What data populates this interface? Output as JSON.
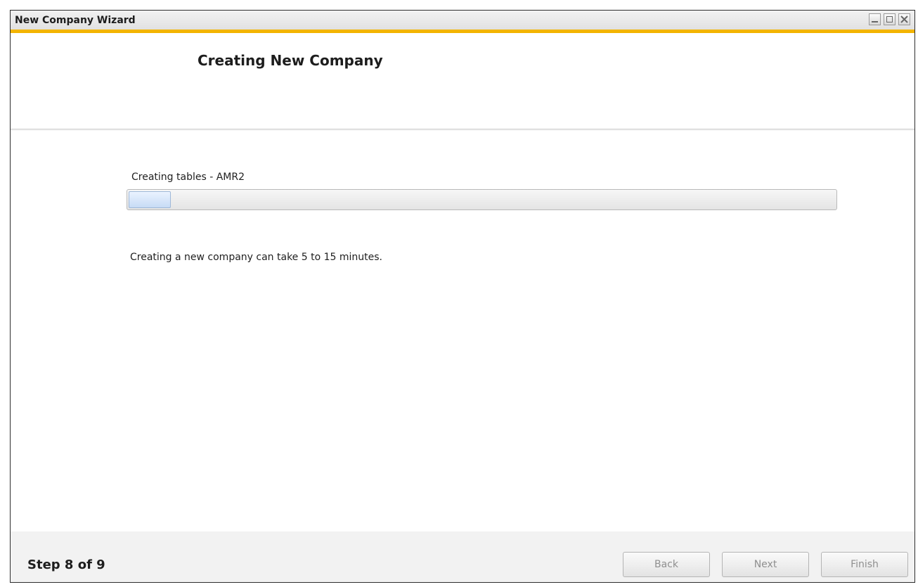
{
  "window": {
    "title": "New Company Wizard"
  },
  "header": {
    "heading": "Creating New Company"
  },
  "content": {
    "progress_label": "Creating tables - AMR2",
    "progress_percent": 6,
    "note": "Creating a new company can take 5 to 15 minutes."
  },
  "footer": {
    "step_text": "Step 8 of 9",
    "buttons": {
      "back": "Back",
      "next": "Next",
      "finish": "Finish"
    }
  },
  "colors": {
    "title_accent": "#f3b400",
    "progress_fill": "#c7dbf5",
    "button_text_disabled": "#8f8f8f"
  },
  "icons": {
    "minimize": "minimize-icon",
    "maximize": "maximize-icon",
    "close": "close-icon"
  }
}
